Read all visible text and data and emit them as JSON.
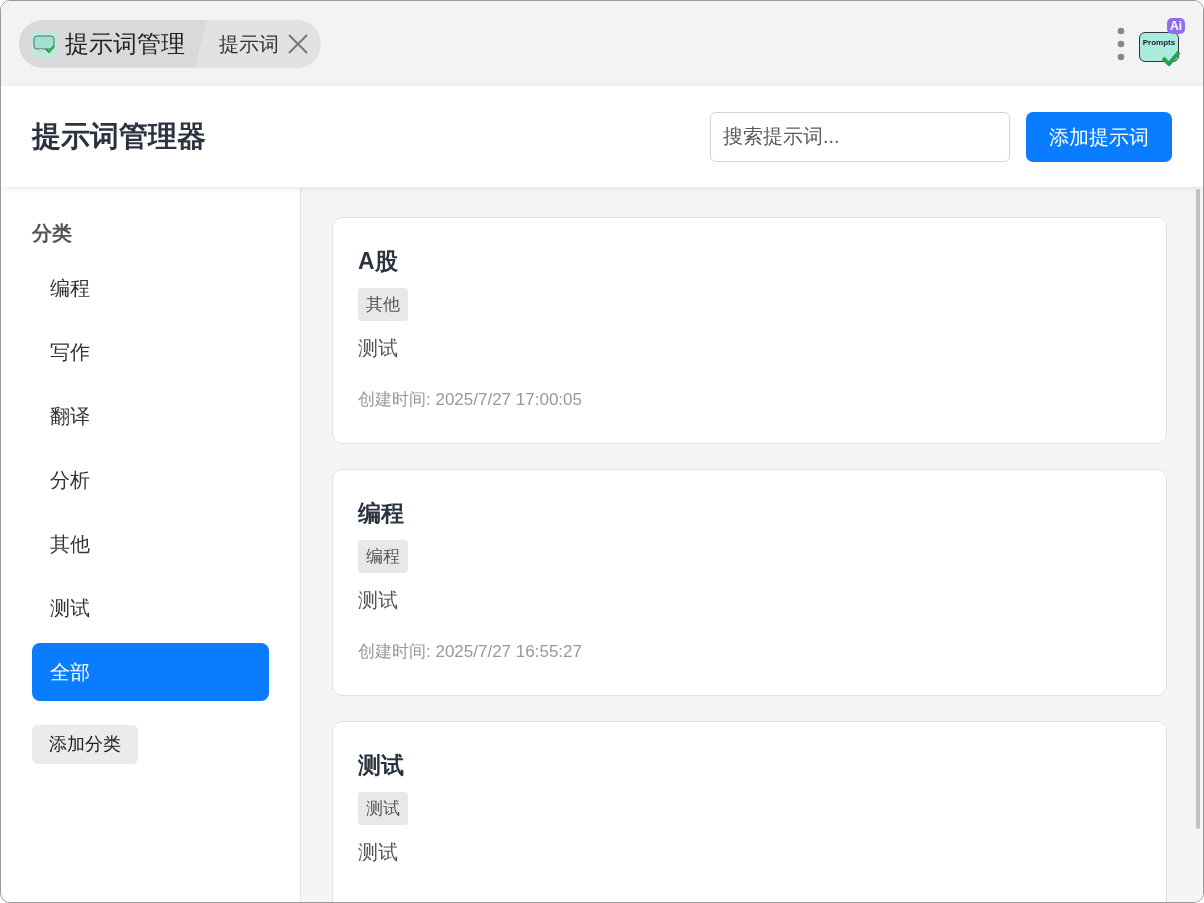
{
  "tabs": [
    {
      "label": "提示词管理",
      "kind": "app",
      "selected": true
    },
    {
      "label": "提示词",
      "kind": "page",
      "selected": false,
      "closable": true
    }
  ],
  "app_logo": {
    "badge": "Ai",
    "label": "Prompts"
  },
  "header": {
    "title": "提示词管理器",
    "search": {
      "placeholder": "搜索提示词..."
    },
    "add_button": "添加提示词"
  },
  "sidebar": {
    "heading": "分类",
    "items": [
      {
        "label": "编程",
        "selected": false
      },
      {
        "label": "写作",
        "selected": false
      },
      {
        "label": "翻译",
        "selected": false
      },
      {
        "label": "分析",
        "selected": false
      },
      {
        "label": "其他",
        "selected": false
      },
      {
        "label": "测试",
        "selected": false
      },
      {
        "label": "全部",
        "selected": true
      }
    ],
    "add_button": "添加分类"
  },
  "prompts": [
    {
      "title": "A股",
      "tag": "其他",
      "content": "测试",
      "created": "创建时间: 2025/7/27 17:00:05"
    },
    {
      "title": "编程",
      "tag": "编程",
      "content": "测试",
      "created": "创建时间: 2025/7/27 16:55:27"
    },
    {
      "title": "测试",
      "tag": "测试",
      "content": "测试"
    }
  ]
}
